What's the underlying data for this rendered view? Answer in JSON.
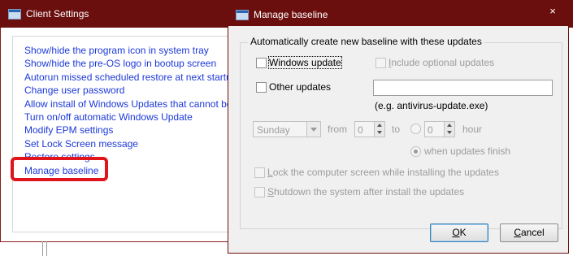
{
  "client_settings": {
    "title": "Client Settings",
    "links": [
      "Show/hide the program icon in system tray",
      "Show/hide the pre-OS logo in bootup screen",
      "Autorun missed scheduled restore at next startup",
      "Change user password",
      "Allow install of Windows Updates that cannot be ro",
      "Turn on/off automatic Windows Update",
      "Modify EPM settings",
      "Set Lock Screen message",
      "Restore settings",
      "Manage baseline"
    ]
  },
  "dialog": {
    "title": "Manage baseline",
    "close_glyph": "×",
    "group_title": "Automatically create new baseline with these updates",
    "windows_update": {
      "label": "Windows update",
      "checked": false
    },
    "include_optional": {
      "label_u": "I",
      "label_rest": "nclude optional updates",
      "checked": false
    },
    "other_updates": {
      "label": "Other updates",
      "checked": false,
      "value": ""
    },
    "example_hint": "(e.g. antivirus-update.exe)",
    "schedule": {
      "day": "Sunday",
      "from_label": "from",
      "from_value": "0",
      "to_label": "to",
      "to_value": "0",
      "hour_label": "hour",
      "when_finish_label": "when updates finish"
    },
    "lock_screen": {
      "label_u": "L",
      "label_rest": "ock the computer screen while installing the updates",
      "checked": false
    },
    "shutdown": {
      "label_u": "S",
      "label_rest": "hutdown the system after install the updates",
      "checked": false
    },
    "ok": {
      "label_u": "O",
      "label_rest": "K"
    },
    "cancel": {
      "label_u": "C",
      "label_rest": "ancel"
    }
  },
  "colors": {
    "titlebar": "#6b0e0e",
    "link": "#1c38d8",
    "highlight": "#e0141a"
  },
  "icons": [
    "window-icon",
    "close-icon",
    "chevron-down-icon",
    "spin-up-icon",
    "spin-down-icon"
  ]
}
